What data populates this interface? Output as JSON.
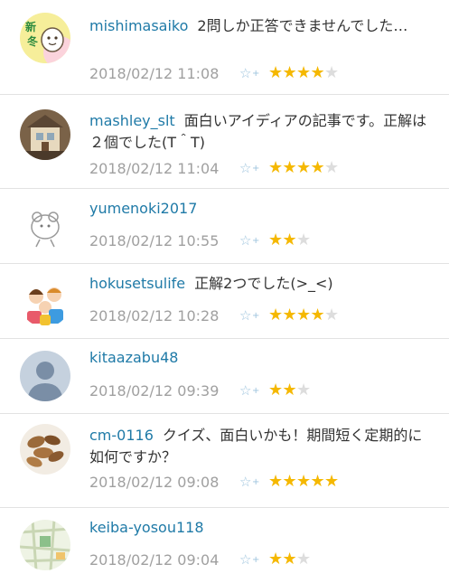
{
  "comments": [
    {
      "user": "mishimasaiko",
      "text": "2問しか正答できませんでした…",
      "date": "2018/02/12 11:08",
      "rating": 4,
      "avatar": "nisetoshi-illustration"
    },
    {
      "user": "mashley_slt",
      "text": "面白いアイディアの記事です。正解は２個でした(T＾T)",
      "date": "2018/02/12 11:04",
      "rating": 4,
      "avatar": "dollhouse-photo"
    },
    {
      "user": "yumenoki2017",
      "text": "",
      "date": "2018/02/12 10:55",
      "rating": 2,
      "avatar": "sketch-character"
    },
    {
      "user": "hokusetsulife",
      "text": "正解2つでした(>_<)",
      "date": "2018/02/12 10:28",
      "rating": 4,
      "avatar": "family-illustration"
    },
    {
      "user": "kitaazabu48",
      "text": "",
      "date": "2018/02/12 09:39",
      "rating": 2,
      "avatar": "default-user"
    },
    {
      "user": "cm-0116",
      "text": "クイズ、面白いかも！期間短く定期的に如何ですか？",
      "date": "2018/02/12 09:08",
      "rating": 5,
      "avatar": "nuts-photo"
    },
    {
      "user": "keiba-yosou118",
      "text": "",
      "date": "2018/02/12 09:04",
      "rating": 2,
      "avatar": "map-image"
    }
  ],
  "max_rating": 5,
  "add_star_icon": "☆+",
  "colors": {
    "username": "#1f7aa7",
    "star_on": "#f5b800",
    "star_off": "#dddddd",
    "date": "#a0a0a0"
  }
}
